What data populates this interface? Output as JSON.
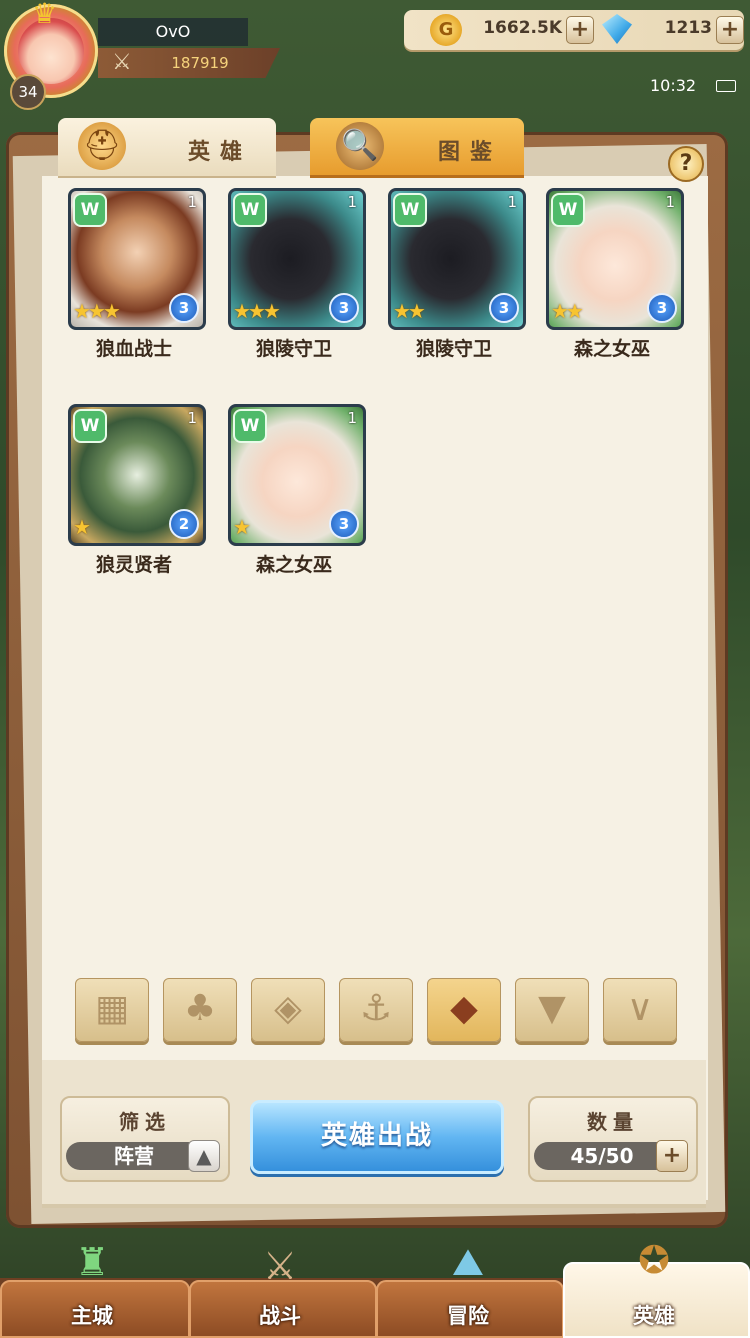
{
  "player": {
    "name": "OvO",
    "level": "34",
    "power": "187919"
  },
  "resources": {
    "gold": "1662.5K",
    "gems": "1213",
    "plus": "+"
  },
  "status": {
    "time": "10:32"
  },
  "tabs": [
    {
      "label": "英雄"
    },
    {
      "label": "图鉴"
    }
  ],
  "help_label": "?",
  "heroes": [
    {
      "name": "狼血战士",
      "copies": "1",
      "stars": "★★★",
      "level": "3",
      "faction_icon": "wolf-faction-icon"
    },
    {
      "name": "狼陵守卫",
      "copies": "1",
      "stars": "★★★",
      "level": "3",
      "faction_icon": "wolf-faction-icon"
    },
    {
      "name": "狼陵守卫",
      "copies": "1",
      "stars": "★★",
      "level": "3",
      "faction_icon": "wolf-faction-icon"
    },
    {
      "name": "森之女巫",
      "copies": "1",
      "stars": "★★",
      "level": "3",
      "faction_icon": "wolf-faction-icon"
    },
    {
      "name": "狼灵贤者",
      "copies": "1",
      "stars": "★",
      "level": "2",
      "faction_icon": "wolf-faction-icon"
    },
    {
      "name": "森之女巫",
      "copies": "1",
      "stars": "★",
      "level": "3",
      "faction_icon": "wolf-faction-icon"
    }
  ],
  "faction_filters": [
    {
      "icon": "grid-icon",
      "active": false
    },
    {
      "icon": "leaf-faction-icon",
      "active": false
    },
    {
      "icon": "diamond-faction-icon",
      "active": false
    },
    {
      "icon": "anchor-faction-icon",
      "active": false
    },
    {
      "icon": "wolf-faction-icon",
      "active": true
    },
    {
      "icon": "demon-faction-icon",
      "active": false
    },
    {
      "icon": "horn-faction-icon",
      "active": false
    }
  ],
  "filter": {
    "title": "筛选",
    "value": "阵营"
  },
  "deploy_label": "英雄出战",
  "count": {
    "title": "数量",
    "value": "45/50"
  },
  "nav": [
    {
      "label": "主城",
      "icon": "castle-icon",
      "active": false
    },
    {
      "label": "战斗",
      "icon": "crossed-swords-icon",
      "active": false
    },
    {
      "label": "冒险",
      "icon": "map-icon",
      "active": false
    },
    {
      "label": "英雄",
      "icon": "hero-crest-icon",
      "active": true
    }
  ],
  "colors": {
    "accent_gold": "#f7c431",
    "deploy_blue": "#62b6f2",
    "wood": "#9c6b43"
  }
}
